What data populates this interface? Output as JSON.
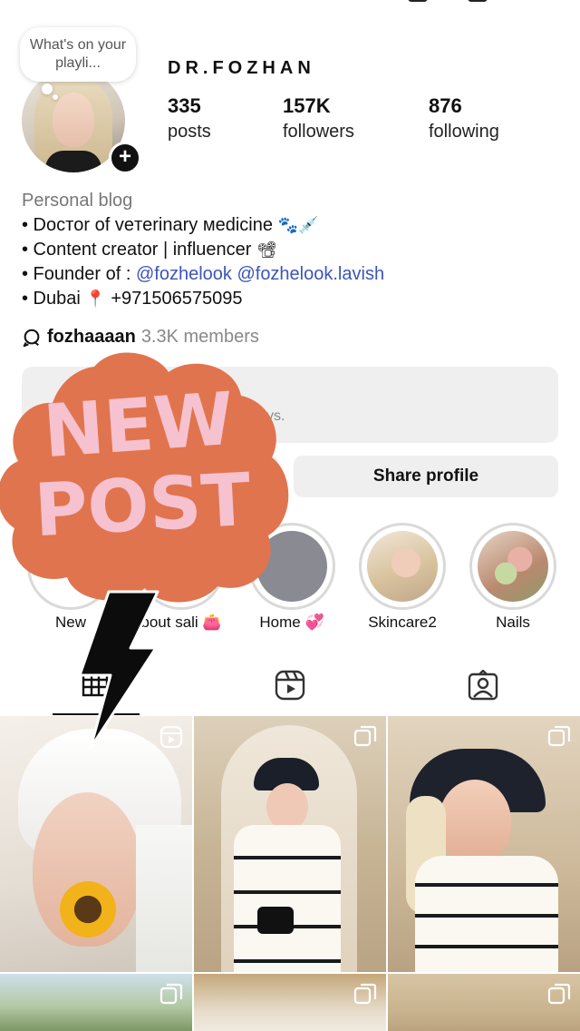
{
  "note": {
    "text": "What's on your playli..."
  },
  "profile": {
    "username": "DR.FOZHAN",
    "stats": {
      "posts": {
        "value": "335",
        "label": "posts"
      },
      "followers": {
        "value": "157K",
        "label": "followers"
      },
      "following": {
        "value": "876",
        "label": "following"
      }
    }
  },
  "bio": {
    "category": "Personal blog",
    "line1": "• Doстor of veтerinary мedicine",
    "line2": "• Content creator | influencer",
    "line3_prefix": "• Founder of :",
    "link1": "@fozhelook",
    "link2": "@fozhelook.lavish",
    "line4_prefix": "• Dubai",
    "phone": "+971506575095",
    "emoji1": "🐾💉",
    "emoji2": "📽",
    "emoji3": "📍"
  },
  "channel": {
    "name": "fozhaaaan",
    "members": "3.3K members"
  },
  "dashboard": {
    "sub_text": "ys."
  },
  "buttons": {
    "share_profile": "Share profile"
  },
  "sticker": {
    "line1": "NEW",
    "line2": "POST"
  },
  "highlights": [
    {
      "label": "New"
    },
    {
      "label": "bout sali 👛"
    },
    {
      "label": "Home 💞"
    },
    {
      "label": "Skincare2"
    },
    {
      "label": "Nails"
    }
  ],
  "tabs": [
    {
      "name": "grid-tab",
      "icon": "grid-icon"
    },
    {
      "name": "reels-tab",
      "icon": "reels-icon"
    },
    {
      "name": "tagged-tab",
      "icon": "tagged-icon"
    }
  ],
  "colors": {
    "sticker_blob": "#e0744e",
    "sticker_text": "#f7c2cf",
    "link": "#3b56b8",
    "button_bg": "#efefef"
  }
}
